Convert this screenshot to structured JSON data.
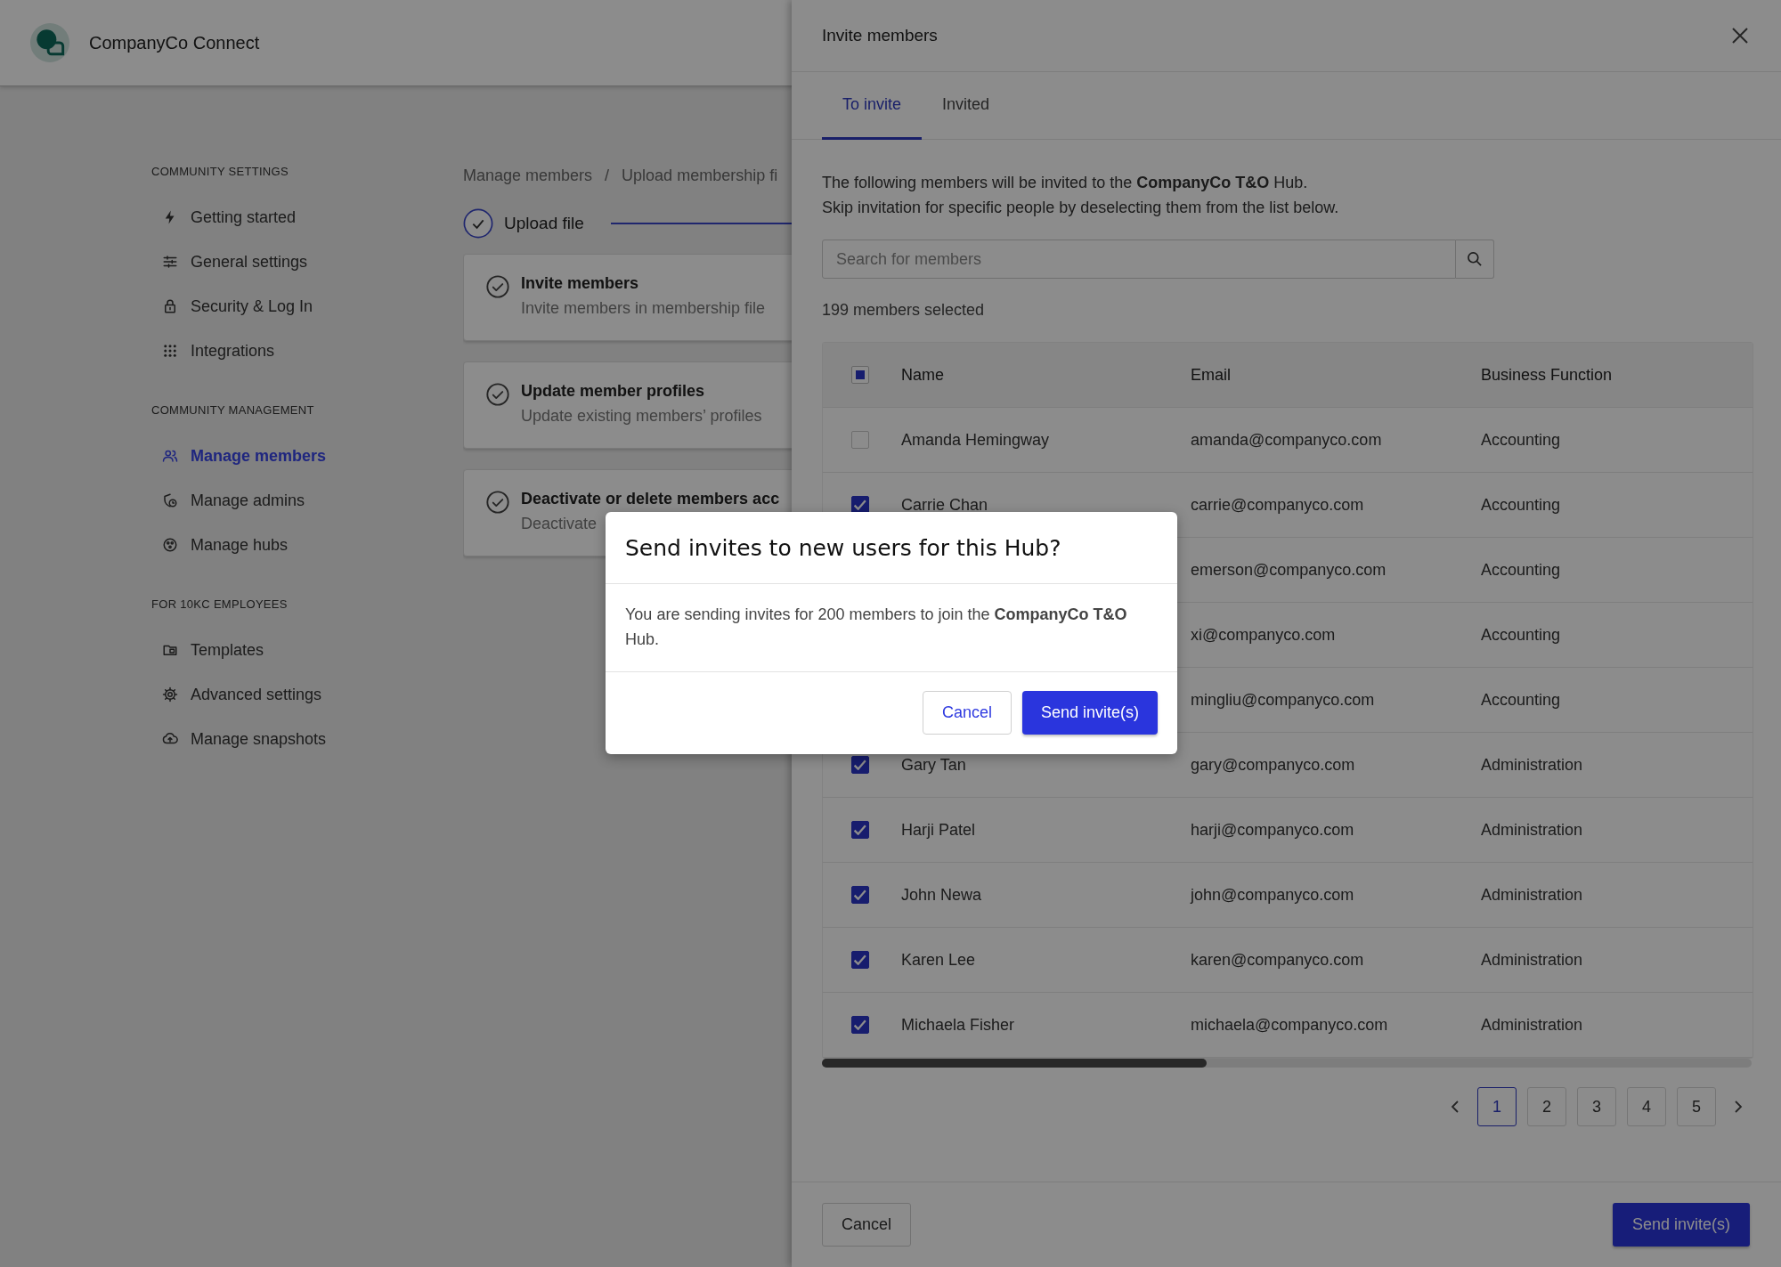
{
  "app": {
    "title": "CompanyCo Connect"
  },
  "sidebar": {
    "sections": [
      {
        "heading": "COMMUNITY SETTINGS",
        "items": [
          {
            "label": "Getting started",
            "selected": false
          },
          {
            "label": "General settings",
            "selected": false
          },
          {
            "label": "Security & Log In",
            "selected": false
          },
          {
            "label": "Integrations",
            "selected": false
          }
        ]
      },
      {
        "heading": "COMMUNITY MANAGEMENT",
        "items": [
          {
            "label": "Manage members",
            "selected": true
          },
          {
            "label": "Manage admins",
            "selected": false
          },
          {
            "label": "Manage hubs",
            "selected": false
          }
        ]
      },
      {
        "heading": "FOR 10KC EMPLOYEES",
        "items": [
          {
            "label": "Templates",
            "selected": false
          },
          {
            "label": "Advanced settings",
            "selected": false
          },
          {
            "label": "Manage snapshots",
            "selected": false
          }
        ]
      }
    ]
  },
  "main": {
    "breadcrumb": {
      "items": [
        "Manage members",
        "Upload membership fi"
      ],
      "separator": "/"
    },
    "stepper": {
      "step": "Upload file"
    },
    "steps": [
      {
        "title": "Invite members",
        "description": "Invite members in membership file"
      },
      {
        "title": "Update member profiles",
        "description": "Update existing members’ profiles"
      },
      {
        "title": "Deactivate or delete members acc",
        "description": "Deactivate"
      }
    ]
  },
  "drawer": {
    "title": "Invite members",
    "tabs": [
      {
        "label": "To invite",
        "selected": true
      },
      {
        "label": "Invited",
        "selected": false
      }
    ],
    "intro": [
      "The following members will be invited to the **CompanyCo T&O** Hub.",
      "Skip invitation for specific people by deselecting them from the list below."
    ],
    "search": {
      "placeholder": "Search for members"
    },
    "selected_count": "199 members selected",
    "table": {
      "columns": [
        "Name",
        "Email",
        "Business Function"
      ],
      "header_checkbox": {
        "indeterminate": true
      },
      "rows": [
        {
          "checked": false,
          "name": "Amanda Hemingway",
          "email": "amanda@companyco.com",
          "function": "Accounting"
        },
        {
          "checked": true,
          "name": "Carrie Chan",
          "email": "carrie@companyco.com",
          "function": "Accounting"
        },
        {
          "email": "emerson@companyco.com",
          "function": "Accounting"
        },
        {
          "email": "xi@companyco.com",
          "function": "Accounting"
        },
        {
          "email": "mingliu@companyco.com",
          "function": "Accounting"
        },
        {
          "checked": true,
          "name": "Gary Tan",
          "email": "gary@companyco.com",
          "function": "Administration"
        },
        {
          "checked": true,
          "name": "Harji Patel",
          "email": "harji@companyco.com",
          "function": "Administration"
        },
        {
          "checked": true,
          "name": "John Newa",
          "email": "john@companyco.com",
          "function": "Administration"
        },
        {
          "checked": true,
          "name": "Karen Lee",
          "email": "karen@companyco.com",
          "function": "Administration"
        },
        {
          "checked": true,
          "name": "Michaela Fisher",
          "email": "michaela@companyco.com",
          "function": "Administration"
        }
      ]
    },
    "pagination": {
      "pages": [
        {
          "label": "1",
          "selected": true
        },
        {
          "label": "2",
          "selected": false
        },
        {
          "label": "3",
          "selected": false
        },
        {
          "label": "4",
          "selected": false
        },
        {
          "label": "5",
          "selected": false
        }
      ]
    },
    "footer": {
      "cancel": "Cancel",
      "submit": "Send invite(s)"
    }
  },
  "modal": {
    "title": "Send invites to new users for this Hub?",
    "message": "You are sending invites for 200 members to join the **CompanyCo T&O** Hub.",
    "cancel": "Cancel",
    "confirm": "Send invite(s)"
  }
}
